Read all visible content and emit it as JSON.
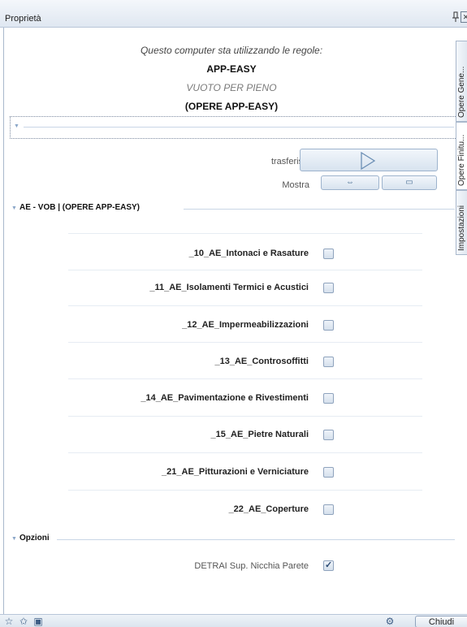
{
  "window": {
    "title": "Proprietà",
    "pin_icon": "pin-icon",
    "close_glyph": "✕"
  },
  "rules": {
    "caption": "Questo computer sta utilizzando le regole:",
    "name": "APP-EASY",
    "mode": "VUOTO PER PIENO",
    "set": "(OPERE APP-EASY)"
  },
  "actions": {
    "transfer_label": "trasferisci",
    "show_label": "Mostra"
  },
  "section_main": {
    "title": "AE - VOB | (OPERE APP-EASY)",
    "items": [
      {
        "label": "_10_AE_Intonaci e Rasature",
        "checked": false
      },
      {
        "label": "_11_AE_Isolamenti Termici e Acustici",
        "checked": false
      },
      {
        "label": "_12_AE_Impermeabilizzazioni",
        "checked": false
      },
      {
        "label": "_13_AE_Controsoffitti",
        "checked": false
      },
      {
        "label": "_14_AE_Pavimentazione e Rivestimenti",
        "checked": false
      },
      {
        "label": "_15_AE_Pietre Naturali",
        "checked": false
      },
      {
        "label": "_21_AE_Pitturazioni e Verniciature",
        "checked": false
      },
      {
        "label": "_22_AE_Coperture",
        "checked": false
      }
    ]
  },
  "section_options": {
    "title": "Opzioni",
    "items": [
      {
        "label": "DETRAI Sup. Nicchia Parete",
        "checked": true
      }
    ]
  },
  "side_tabs": [
    "Opere Gene...",
    "Opere Finitu...",
    "Impostazioni"
  ],
  "footer": {
    "close_label": "Chiudi"
  },
  "colors": {
    "accent": "#9db3cd",
    "checkbox_mark": "#2b4a73"
  }
}
